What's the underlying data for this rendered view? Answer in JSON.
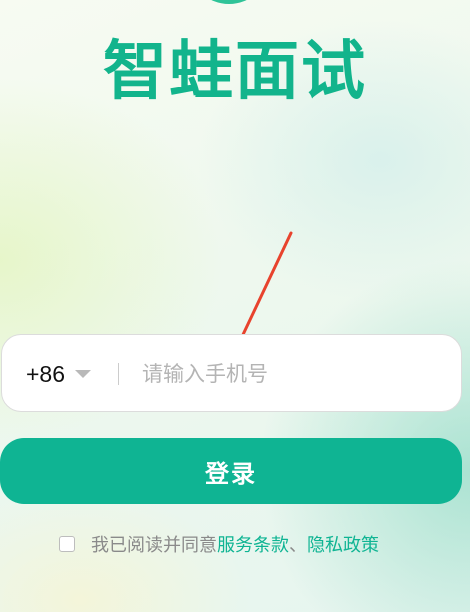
{
  "app": {
    "title": "智蛙面试"
  },
  "login": {
    "country_code": "+86",
    "phone_placeholder": "请输入手机号",
    "phone_value": "",
    "submit_label": "登录"
  },
  "agreement": {
    "prefix": "我已阅读并同意",
    "terms_link": "服务条款",
    "separator": "、",
    "privacy_link": "隐私政策",
    "checked": false
  },
  "colors": {
    "brand": "#12b48c",
    "button": "#0fb493",
    "annotation_arrow": "#e8432d"
  },
  "icons": {
    "country_dropdown": "chevron-down-icon",
    "logo": "logo-arc-icon",
    "annotation": "arrow-icon"
  }
}
